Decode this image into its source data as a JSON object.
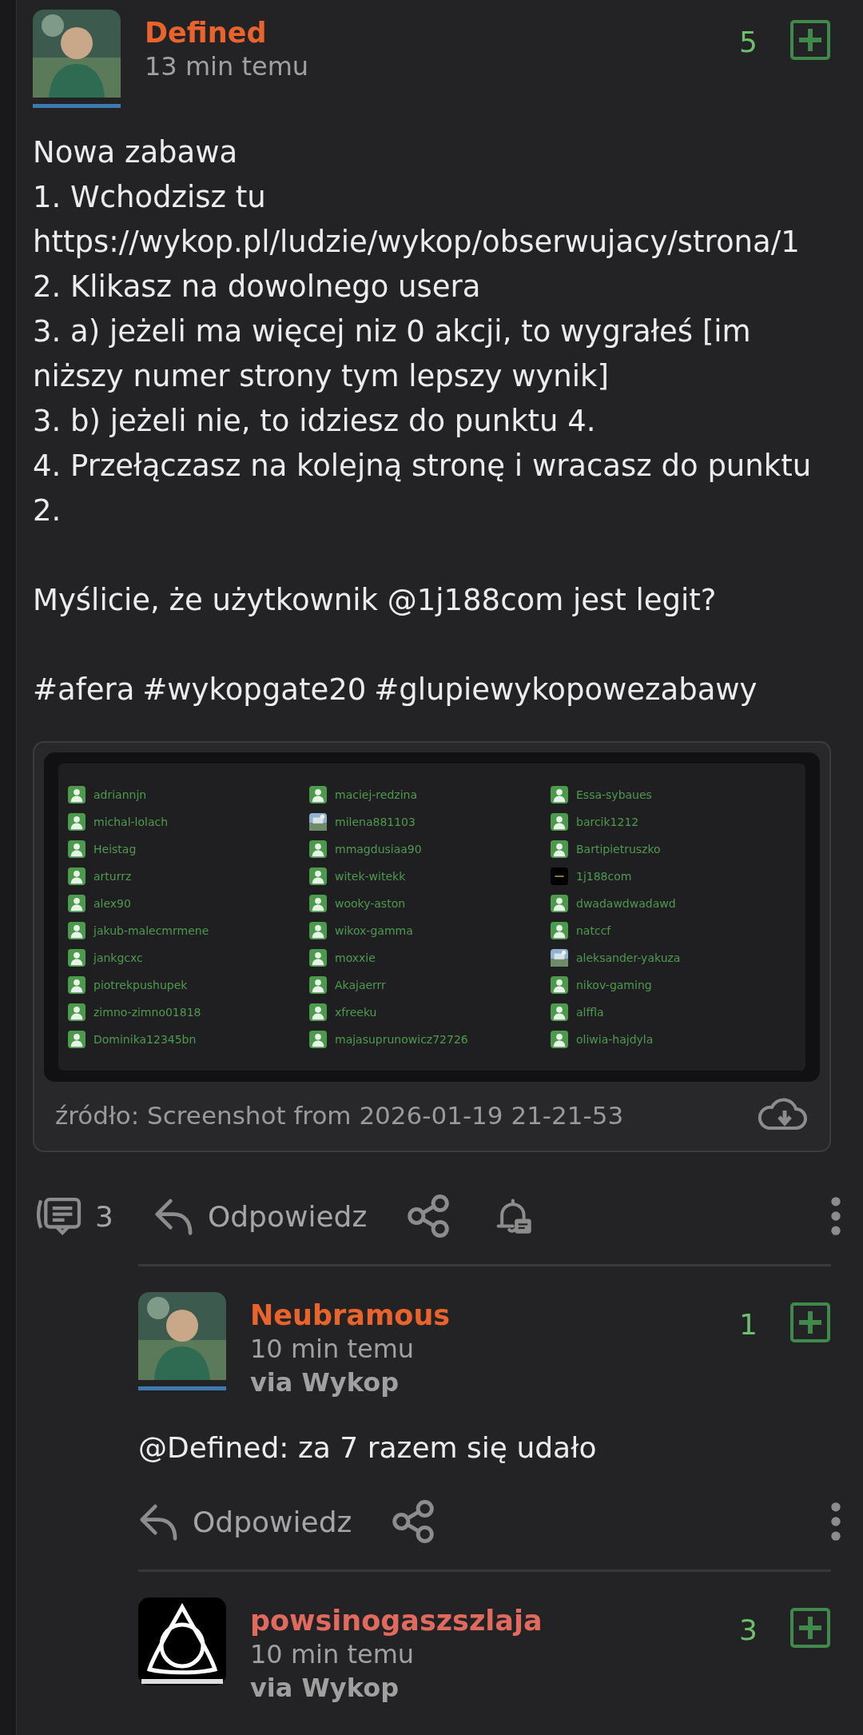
{
  "post": {
    "author": {
      "name": "Defined",
      "color": "#e8642c",
      "underline": true
    },
    "time": "13 min temu",
    "votes": "5",
    "paragraphs": [
      [
        "Nowa zabawa",
        "1. Wchodzisz tu",
        "https://wykop.pl/ludzie/wykop/obserwujacy/strona/1",
        "2. Klikasz na dowolnego usera",
        "3. a) jeżeli ma więcej niz 0 akcji, to wygrałeś [im niższy numer strony tym lepszy wynik]",
        "3. b) jeżeli nie, to idziesz do punktu 4.",
        "4. Przełączasz na kolejną stronę i wracasz do punktu 2."
      ],
      [
        "Myślicie, że użytkownik @1j188com jest legit?"
      ]
    ],
    "tags": [
      "#afera",
      "#wykopgate20",
      "#glupiewykopowezabawy"
    ],
    "attachment": {
      "users": [
        {
          "name": "adriannjn",
          "kind": "default"
        },
        {
          "name": "michal-lolach",
          "kind": "default"
        },
        {
          "name": "Heistag",
          "kind": "default"
        },
        {
          "name": "arturrz",
          "kind": "default"
        },
        {
          "name": "alex90",
          "kind": "default"
        },
        {
          "name": "jakub-malecmrmene",
          "kind": "default"
        },
        {
          "name": "jankgcxc",
          "kind": "default"
        },
        {
          "name": "piotrekpushupek",
          "kind": "default"
        },
        {
          "name": "zimno-zimno01818",
          "kind": "default"
        },
        {
          "name": "Dominika12345bn",
          "kind": "default"
        },
        {
          "name": "maciej-redzina",
          "kind": "default"
        },
        {
          "name": "milena881103",
          "kind": "picture"
        },
        {
          "name": "mmagdusiaa90",
          "kind": "default"
        },
        {
          "name": "witek-witekk",
          "kind": "default"
        },
        {
          "name": "wooky-aston",
          "kind": "default"
        },
        {
          "name": "wikox-gamma",
          "kind": "default"
        },
        {
          "name": "moxxie",
          "kind": "default"
        },
        {
          "name": "Akajaerrr",
          "kind": "default"
        },
        {
          "name": "xfreeku",
          "kind": "default"
        },
        {
          "name": "majasuprunowicz72726",
          "kind": "default"
        },
        {
          "name": "Essa-sybaues",
          "kind": "default"
        },
        {
          "name": "barcik1212",
          "kind": "default"
        },
        {
          "name": "Bartipietruszko",
          "kind": "default"
        },
        {
          "name": "1j188com",
          "kind": "dark"
        },
        {
          "name": "dwadawdwadawd",
          "kind": "default"
        },
        {
          "name": "natccf",
          "kind": "default"
        },
        {
          "name": "aleksander-yakuza",
          "kind": "picture"
        },
        {
          "name": "nikov-gaming",
          "kind": "default"
        },
        {
          "name": "alffla",
          "kind": "default"
        },
        {
          "name": "oliwia-hajdyla",
          "kind": "default"
        }
      ],
      "source": "źródło: Screenshot from 2026-01-19 21-21-53"
    },
    "actions": {
      "comments": "3",
      "reply": "Odpowiedz"
    }
  },
  "comments": [
    {
      "author": {
        "name": "Neubramous",
        "color": "#e8642c",
        "underline": true
      },
      "time": "10 min temu",
      "via": "via Wykop",
      "votes": "1",
      "text": "@Defined: za 7 razem się udało",
      "reply": "Odpowiedz"
    },
    {
      "author": {
        "name": "powsinogaszszlaja",
        "color": "#e06a5e",
        "avatar": {
          "kind": "logo"
        },
        "underline": false
      },
      "time": "10 min temu",
      "via": "via Wykop",
      "votes": "3"
    }
  ]
}
